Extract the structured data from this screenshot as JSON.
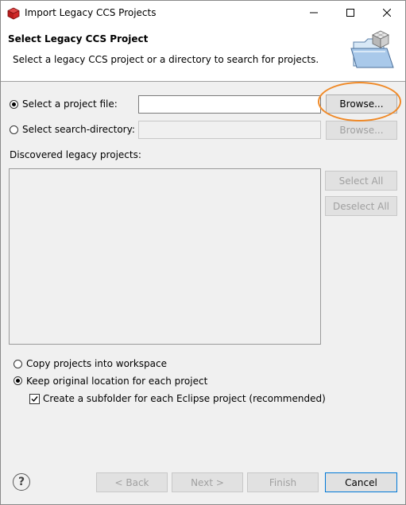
{
  "window": {
    "title": "Import Legacy CCS Projects",
    "app_icon": "ccs-cube-icon"
  },
  "titlebar_buttons": {
    "minimize_icon": "minimize-icon",
    "maximize_icon": "maximize-icon",
    "close_icon": "close-icon"
  },
  "header": {
    "title": "Select Legacy CCS Project",
    "description": "Select a legacy CCS project or a directory to search for projects.",
    "image_icon": "folder-import-wizard-icon"
  },
  "source": {
    "project_file_label": "Select a project file:",
    "project_file_value": "",
    "project_file_selected": true,
    "browse_file_label": "Browse...",
    "search_dir_label": "Select search-directory:",
    "search_dir_value": "",
    "search_dir_selected": false,
    "browse_dir_label": "Browse..."
  },
  "projects": {
    "label": "Discovered legacy projects:",
    "items": [],
    "select_all_label": "Select All",
    "deselect_all_label": "Deselect All"
  },
  "options": {
    "copy_label": "Copy projects into workspace",
    "copy_selected": false,
    "keep_label": "Keep original location for each project",
    "keep_selected": true,
    "subfolder_label": "Create a subfolder for each Eclipse project (recommended)",
    "subfolder_checked": true
  },
  "footer": {
    "help_icon": "help-icon",
    "help_glyph": "?",
    "back_label": "< Back",
    "next_label": "Next >",
    "finish_label": "Finish",
    "cancel_label": "Cancel"
  },
  "colors": {
    "highlight_ring": "#f08a28",
    "focus_border": "#0078d7",
    "disabled_text": "#a0a0a0"
  }
}
